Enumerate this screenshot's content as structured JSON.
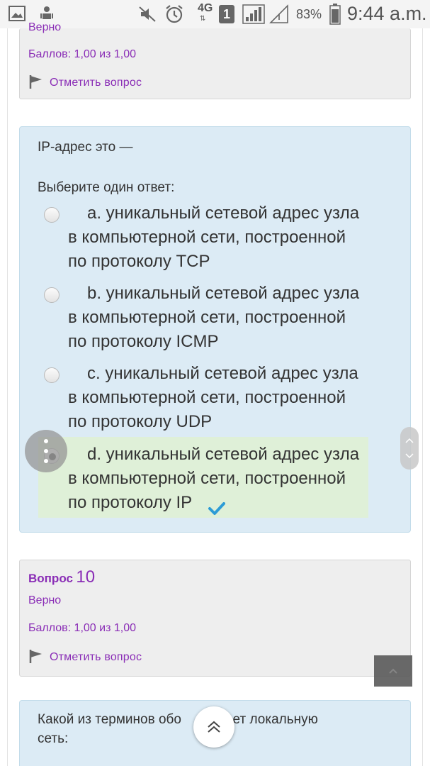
{
  "status_bar": {
    "network": "4G",
    "sim_slot": "1",
    "battery": "83%",
    "time": "9:44 a.m.",
    "icons": [
      "gallery-icon",
      "android-icon",
      "mute-icon",
      "alarm-icon",
      "signal-icon",
      "no-signal-icon"
    ]
  },
  "prev_question": {
    "status": "Верно",
    "score": "Баллов: 1,00 из 1,00",
    "flag_label": "Отметить вопрос"
  },
  "question9": {
    "text": "IP-адрес это —",
    "prompt": "Выберите один ответ:",
    "options": [
      {
        "label": "a. уникальный сетевой адрес узла в компьютерной сети, построенной по протоколу TCP",
        "selected": false
      },
      {
        "label": "b. уникальный сетевой адрес узла в компьютерной сети, построенной по протоколу ICMP",
        "selected": false
      },
      {
        "label": "c. уникальный сетевой адрес узла в компьютерной сети, построенной по протоколу UDP",
        "selected": false
      },
      {
        "label": "d. уникальный сетевой адрес узла в компьютерной сети, построенной по протоколу IP",
        "selected": true,
        "correct": true
      }
    ]
  },
  "question10_info": {
    "label": "Вопрос",
    "number": "10",
    "status": "Верно",
    "score": "Баллов: 1,00 из 1,00",
    "flag_label": "Отметить вопрос"
  },
  "question10": {
    "text": "Какой из терминов обо",
    "text_hidden_tail": "ает локальную",
    "text_line2": "сеть:"
  },
  "colors": {
    "accent_purple": "#8a2db6",
    "question_bg": "#dcebf5",
    "correct_bg": "#dff0d8",
    "check": "#2d9cd6"
  }
}
